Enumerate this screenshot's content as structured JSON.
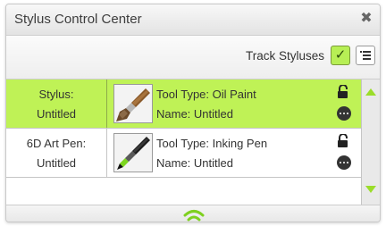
{
  "window": {
    "title": "Stylus Control Center",
    "close_glyph": "✖"
  },
  "toolbar": {
    "track_label": "Track Styluses",
    "track_checked": true,
    "check_glyph": "✓",
    "list_icon": "list-icon"
  },
  "styluses": [
    {
      "pen_line1": "Stylus:",
      "pen_line2": "Untitled",
      "tool_type": "Tool Type: Oil Paint",
      "name": "Name: Untitled",
      "selected": true,
      "thumb_icon": "oil-paint-brush-icon",
      "lock_icon": "unlocked-padlock-icon",
      "more_icon": "more-options-icon"
    },
    {
      "pen_line1": "6D Art Pen:",
      "pen_line2": "Untitled",
      "tool_type": "Tool Type: Inking Pen",
      "name": "Name: Untitled",
      "selected": false,
      "thumb_icon": "inking-pen-icon",
      "lock_icon": "unlocked-padlock-icon",
      "more_icon": "more-options-icon"
    }
  ],
  "footer": {
    "status_icon": "connection-signal-icon"
  },
  "colors": {
    "selected_row": "#bff256",
    "accent_green": "#9bdd2a",
    "check_bg": "#b7ef55"
  }
}
